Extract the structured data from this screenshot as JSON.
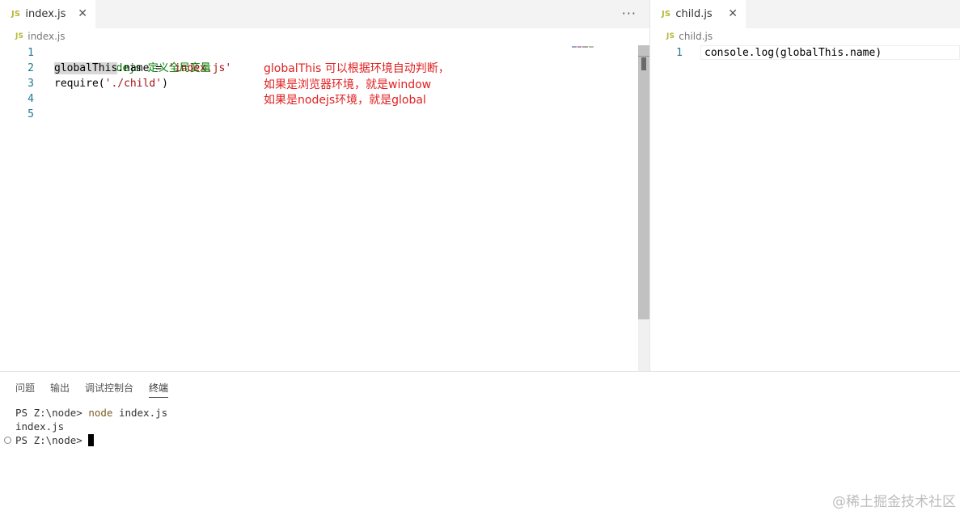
{
  "left_editor": {
    "tab": {
      "badge": "JS",
      "label": "index.js",
      "close": "✕"
    },
    "more_actions": "···",
    "breadcrumb": {
      "badge": "JS",
      "label": "index.js"
    },
    "line_numbers": [
      "1",
      "2",
      "3",
      "4",
      "5"
    ],
    "code": {
      "line1_comment": "nodejs 定义全局变量",
      "line2_hl": "globalThis",
      "line2_rest": ".name = ",
      "line2_string": "'index.js'",
      "line3_prefix": "require(",
      "line3_string": "'./child'",
      "line3_suffix": ")"
    },
    "annotation": [
      "globalThis 可以根据环境自动判断，",
      "如果是浏览器环境，就是window",
      "如果是nodejs环境，就是global"
    ]
  },
  "right_editor": {
    "tab": {
      "badge": "JS",
      "label": "child.js",
      "close": "✕"
    },
    "breadcrumb": {
      "badge": "JS",
      "label": "child.js"
    },
    "line_numbers": [
      "1"
    ],
    "code_line1": "console.log(globalThis.name)"
  },
  "panel": {
    "tabs": [
      "问题",
      "输出",
      "调试控制台",
      "终端"
    ],
    "active_tab": "终端",
    "terminal": {
      "prompt1": "PS Z:\\node> ",
      "cmd1": "node",
      "args1": " index.js",
      "output": "index.js",
      "prompt2": "PS Z:\\node> "
    }
  },
  "watermark": "@稀土掘金技术社区",
  "colors": {
    "annotation": "#e02020",
    "comment": "#008000",
    "string": "#a31515",
    "js_badge": "#b7b73b",
    "line_number": "#237893"
  }
}
